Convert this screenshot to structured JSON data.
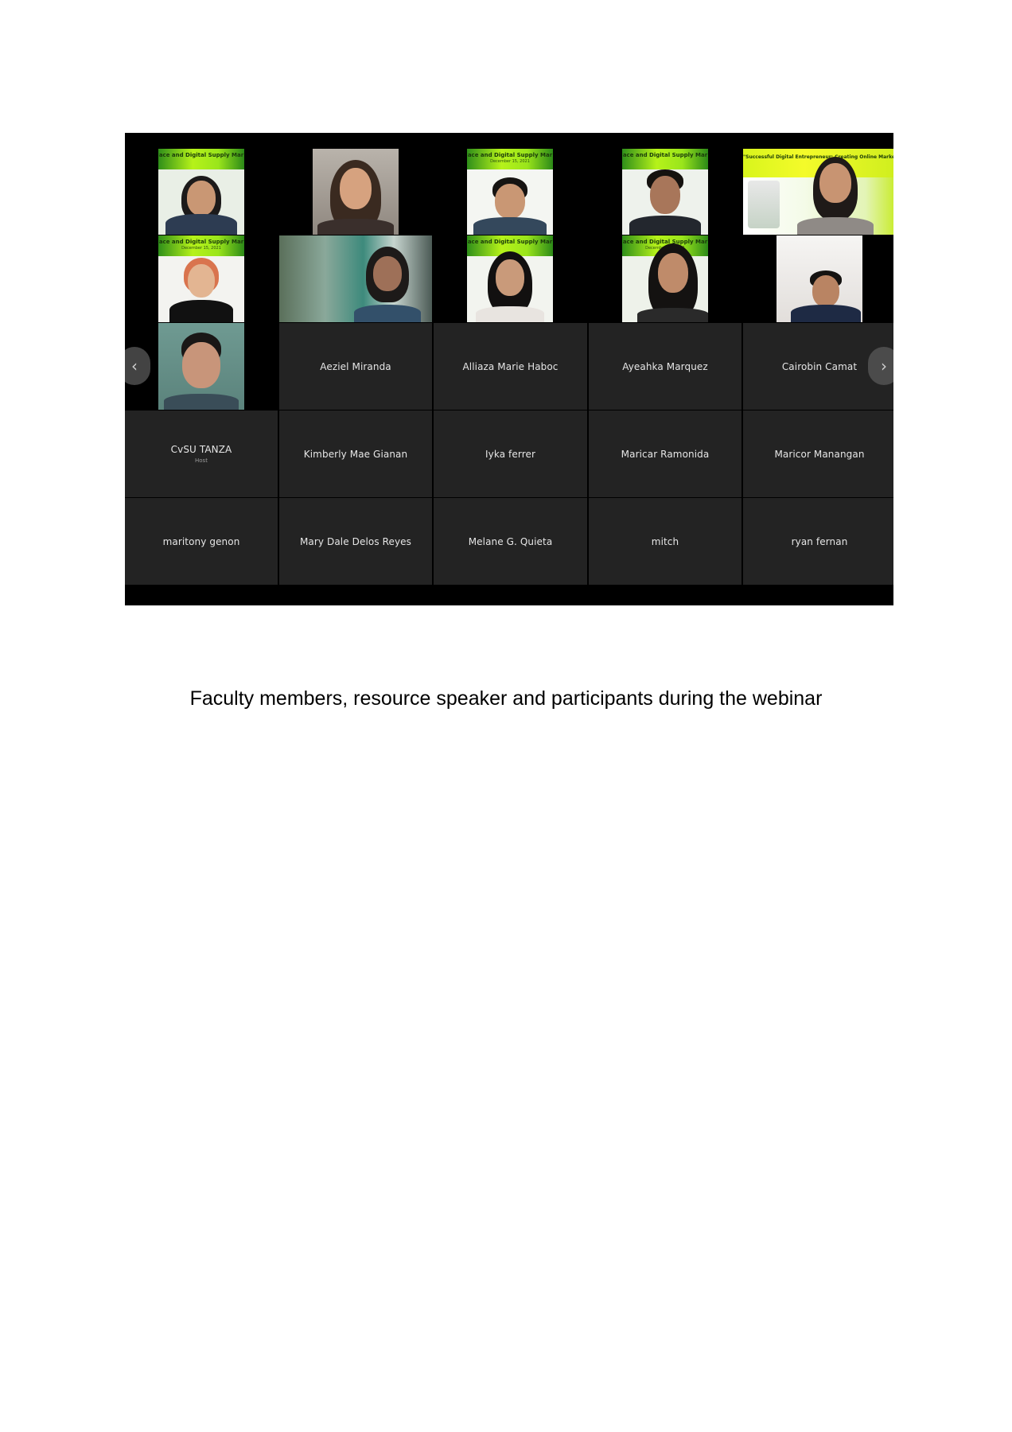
{
  "gallery": {
    "banner": {
      "title": "ace and Digital Supply Mar",
      "date": "December 15, 2021",
      "speaker_title": "\"Successful Digital Entrepreneur: Creating Online Marketplace and Digital Supply Chain Management\""
    },
    "named_tiles": [
      {
        "name": "Aeziel Miranda"
      },
      {
        "name": "Alliaza Marie Haboc"
      },
      {
        "name": "Ayeahka Marquez"
      },
      {
        "name": "Cairobin Camat"
      },
      {
        "name": "CvSU TANZA",
        "sub": "Host"
      },
      {
        "name": "Kimberly Mae Gianan"
      },
      {
        "name": "Iyka ferrer"
      },
      {
        "name": "Maricar Ramonida"
      },
      {
        "name": "Maricor Manangan"
      },
      {
        "name": "maritony genon"
      },
      {
        "name": "Mary Dale Delos Reyes"
      },
      {
        "name": "Melane G. Quieta"
      },
      {
        "name": "mitch"
      },
      {
        "name": "ryan fernan"
      }
    ],
    "nav": {
      "prev_icon": "chevron-left-icon",
      "next_icon": "chevron-right-icon",
      "prev_glyph": "‹",
      "next_glyph": "›"
    }
  },
  "caption": "Faculty members, resource speaker and participants during the webinar"
}
